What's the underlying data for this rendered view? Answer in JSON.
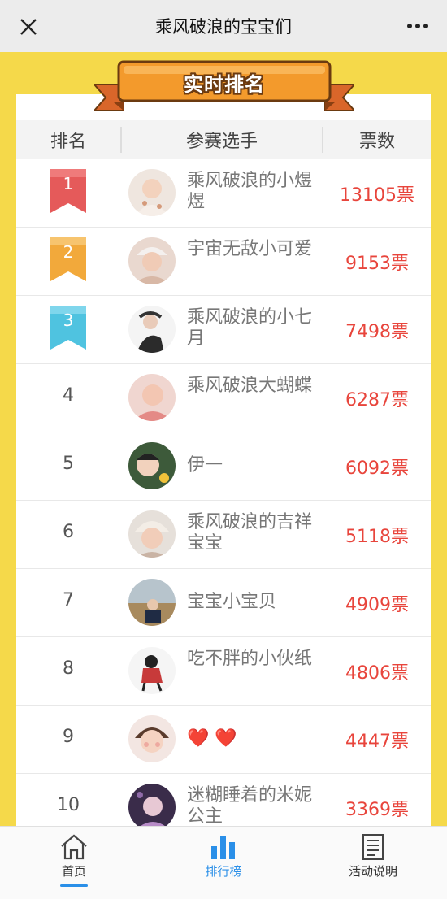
{
  "header": {
    "title": "乘风破浪的宝宝们"
  },
  "banner": {
    "title": "实时排名"
  },
  "table": {
    "col_rank": "排名",
    "col_player": "参赛选手",
    "col_votes": "票数"
  },
  "colors": {
    "accent_red": "#e8453c",
    "medal_1": "#e55a5a",
    "medal_2": "#f2a93b",
    "medal_3": "#4fc3e0",
    "background": "#f5d94a",
    "active_tab": "#2a8fe8"
  },
  "rows": [
    {
      "rank": "1",
      "name": "乘风破浪的小煜煜",
      "votes": "13105票"
    },
    {
      "rank": "2",
      "name": "宇宙无敌小可爱",
      "votes": "9153票"
    },
    {
      "rank": "3",
      "name": "乘风破浪的小七月",
      "votes": "7498票"
    },
    {
      "rank": "4",
      "name": "乘风破浪大蝴蝶",
      "votes": "6287票"
    },
    {
      "rank": "5",
      "name": "伊一",
      "votes": "6092票"
    },
    {
      "rank": "6",
      "name": "乘风破浪的吉祥宝宝",
      "votes": "5118票"
    },
    {
      "rank": "7",
      "name": "宝宝小宝贝",
      "votes": "4909票"
    },
    {
      "rank": "8",
      "name": "吃不胖的小伙纸",
      "votes": "4806票"
    },
    {
      "rank": "9",
      "name": "❤️ ❤️",
      "votes": "4447票"
    },
    {
      "rank": "10",
      "name": "迷糊睡着的米妮公主",
      "votes": "3369票"
    }
  ],
  "tabs": [
    {
      "label": "首页",
      "icon": "home-icon"
    },
    {
      "label": "排行榜",
      "icon": "bar-chart-icon"
    },
    {
      "label": "活动说明",
      "icon": "document-icon"
    }
  ]
}
